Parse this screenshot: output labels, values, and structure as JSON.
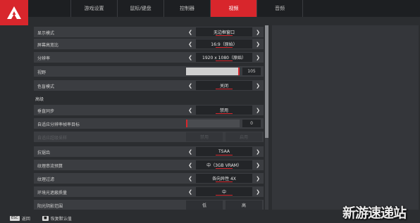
{
  "tabs": [
    {
      "label": "游戏设置",
      "active": false
    },
    {
      "label": "鼠标/键盘",
      "active": false
    },
    {
      "label": "控制器",
      "active": false
    },
    {
      "label": "视频",
      "active": true
    },
    {
      "label": "音频",
      "active": false
    }
  ],
  "settings": {
    "display_mode": {
      "label": "显示模式",
      "value": "无边框窗口"
    },
    "aspect_ratio": {
      "label": "屏幕高宽比",
      "value": "16:9（原始）"
    },
    "resolution": {
      "label": "分辨率",
      "value": "1920 x 1080（原始）"
    },
    "fov": {
      "label": "视野",
      "value": "105",
      "level": 0.97
    },
    "color_mode": {
      "label": "色盲模式",
      "value": "关闭"
    },
    "advanced_header": "高级",
    "vsync": {
      "label": "垂直同步",
      "value": "禁用"
    },
    "adaptive_target": {
      "label": "自适应分辨率帧率目标",
      "value": "0",
      "level": 0.0
    },
    "adaptive_supersample": {
      "label": "自适应超级采样",
      "option_a": "禁用",
      "option_b": "启用"
    },
    "antialiasing": {
      "label": "抗锯齿",
      "value": "TSAA"
    },
    "texture_budget": {
      "label": "纹理串流预算",
      "value": "中（3GB VRAM）"
    },
    "texture_filter": {
      "label": "纹理过滤",
      "value": "各向异性 4X"
    },
    "ambient_occlusion": {
      "label": "环境光遮蔽质量",
      "value": "中"
    },
    "sun_shadow": {
      "label": "阳光阴影范围",
      "option_a": "低",
      "option_b": "高"
    }
  },
  "footer": {
    "back_key": "ESC",
    "back_label": "返回",
    "reset_label": "恢复默认值"
  },
  "watermark": "新游速递站",
  "colors": {
    "accent": "#d8262c",
    "background": "#2b2d30",
    "row": "#3b3d41"
  }
}
